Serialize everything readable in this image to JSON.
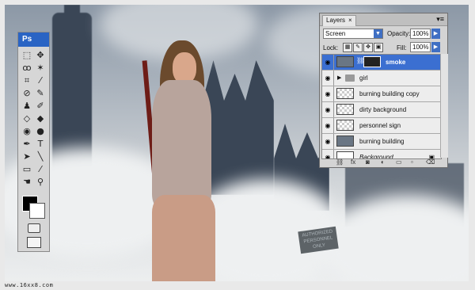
{
  "toolbox": {
    "logo": "Ps",
    "tools": [
      {
        "name": "marquee-tool",
        "icon": "⬚"
      },
      {
        "name": "move-tool",
        "icon": "✥"
      },
      {
        "name": "lasso-tool",
        "icon": "ꝏ"
      },
      {
        "name": "magic-wand-tool",
        "icon": "✶"
      },
      {
        "name": "crop-tool",
        "icon": "⌗"
      },
      {
        "name": "eyedropper-tool",
        "icon": "⁄"
      },
      {
        "name": "healing-brush-tool",
        "icon": "⊘"
      },
      {
        "name": "brush-tool",
        "icon": "✎"
      },
      {
        "name": "clone-stamp-tool",
        "icon": "♟"
      },
      {
        "name": "history-brush-tool",
        "icon": "✐"
      },
      {
        "name": "eraser-tool",
        "icon": "◇"
      },
      {
        "name": "paint-bucket-tool",
        "icon": "◆"
      },
      {
        "name": "blur-tool",
        "icon": "◉"
      },
      {
        "name": "dodge-tool",
        "icon": "●"
      },
      {
        "name": "pen-tool",
        "icon": "✒"
      },
      {
        "name": "type-tool",
        "icon": "T"
      },
      {
        "name": "path-selection-tool",
        "icon": "➤"
      },
      {
        "name": "line-tool",
        "icon": "╲"
      },
      {
        "name": "notes-tool",
        "icon": "▭"
      },
      {
        "name": "eyedropper2-tool",
        "icon": "⁄"
      },
      {
        "name": "hand-tool",
        "icon": "☚"
      },
      {
        "name": "zoom-tool",
        "icon": "⚲"
      }
    ],
    "foreground_color": "#000000",
    "background_color": "#ffffff"
  },
  "layers_panel": {
    "tab_label": "Layers",
    "tab_close": "×",
    "blend_mode": "Screen",
    "opacity_label": "Opacity:",
    "opacity_value": "100%",
    "lock_label": "Lock:",
    "fill_label": "Fill:",
    "fill_value": "100%",
    "layers": [
      {
        "name": "smoke",
        "selected": true,
        "thumb": "photo",
        "has_mask": true,
        "type": "layer"
      },
      {
        "name": "girl",
        "selected": false,
        "type": "group"
      },
      {
        "name": "burning building copy",
        "selected": false,
        "thumb": "checker",
        "type": "layer"
      },
      {
        "name": "dirty background",
        "selected": false,
        "thumb": "checker",
        "type": "layer"
      },
      {
        "name": "personnel sign",
        "selected": false,
        "thumb": "checker",
        "type": "layer"
      },
      {
        "name": "burning building",
        "selected": false,
        "thumb": "photo",
        "type": "layer"
      },
      {
        "name": "Background",
        "selected": false,
        "thumb": "solid",
        "type": "background",
        "locked": true
      }
    ],
    "footer_icons": [
      "link-icon",
      "fx-icon",
      "mask-icon",
      "adjustment-icon",
      "folder-icon",
      "new-layer-icon",
      "trash-icon"
    ]
  },
  "sign_text": "AUTHORIZED PERSONNEL ONLY",
  "watermark": "www.16xx8.com",
  "colors": {
    "accent": "#3b6fd1",
    "ps_blue": "#2a64c4"
  }
}
